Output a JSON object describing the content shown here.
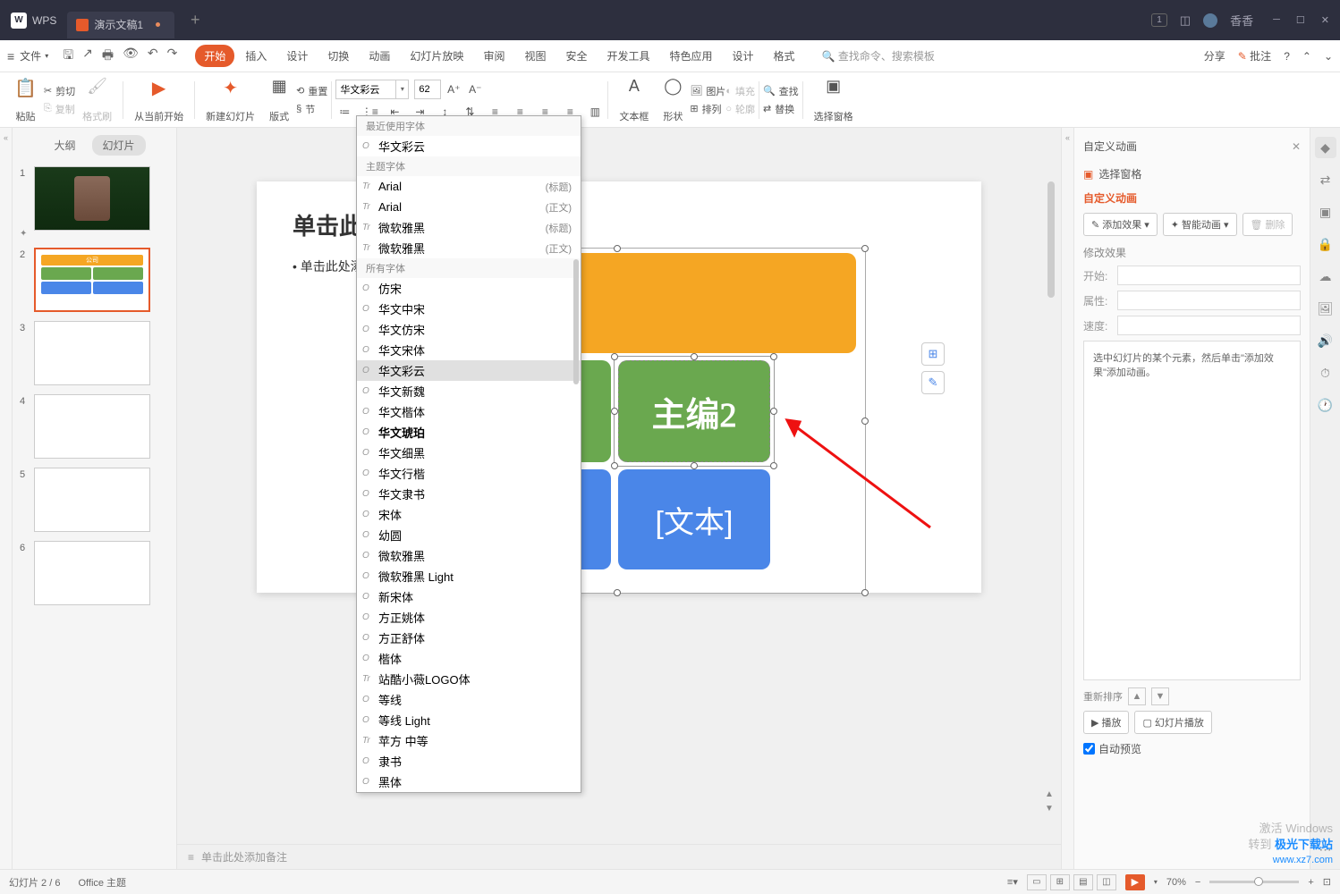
{
  "titlebar": {
    "app_name": "WPS",
    "doc_tab": "演示文稿1",
    "user_name": "香香",
    "badge": "1"
  },
  "menubar": {
    "file_label": "文件",
    "tabs": [
      "开始",
      "插入",
      "设计",
      "切换",
      "动画",
      "幻灯片放映",
      "审阅",
      "视图",
      "安全",
      "开发工具",
      "特色应用",
      "设计",
      "格式"
    ],
    "active_tab_index": 0,
    "search_placeholder": "查找命令、搜索模板",
    "share": "分享",
    "annotate": "批注"
  },
  "ribbon": {
    "paste": "粘贴",
    "cut": "剪切",
    "copy": "复制",
    "format_painter": "格式刷",
    "from_current": "从当前开始",
    "new_slide": "新建幻灯片",
    "layout": "版式",
    "section": "节",
    "reset": "重置",
    "font_name": "华文彩云",
    "font_size": "62",
    "text_box": "文本框",
    "shape": "形状",
    "picture": "图片",
    "arrange": "排列",
    "fill": "填充",
    "outline": "轮廓",
    "find": "查找",
    "replace": "替换",
    "select_pane": "选择窗格"
  },
  "left_panel": {
    "outline_tab": "大纲",
    "slides_tab": "幻灯片",
    "slide_count": 6,
    "selected": 2
  },
  "slide": {
    "title_text": "单击此处添加",
    "bullet_text": "单击此处添",
    "sa_selected_text": "主编2",
    "sa_text_placeholder": "[文本]"
  },
  "font_dropdown": {
    "section_recent": "最近使用字体",
    "recent": [
      {
        "name": "华文彩云",
        "icon": "O"
      }
    ],
    "section_theme": "主题字体",
    "theme": [
      {
        "name": "Arial",
        "tag": "(标题)",
        "icon": "Tr"
      },
      {
        "name": "Arial",
        "tag": "(正文)",
        "icon": "Tr"
      },
      {
        "name": "微软雅黑",
        "tag": "(标题)",
        "icon": "Tr"
      },
      {
        "name": "微软雅黑",
        "tag": "(正文)",
        "icon": "Tr"
      }
    ],
    "section_all": "所有字体",
    "all": [
      {
        "name": "仿宋",
        "icon": "O"
      },
      {
        "name": "华文中宋",
        "icon": "O"
      },
      {
        "name": "华文仿宋",
        "icon": "O"
      },
      {
        "name": "华文宋体",
        "icon": "O"
      },
      {
        "name": "华文彩云",
        "icon": "O",
        "hover": true
      },
      {
        "name": "华文新魏",
        "icon": "O"
      },
      {
        "name": "华文楷体",
        "icon": "O"
      },
      {
        "name": "华文琥珀",
        "icon": "O",
        "bold": true
      },
      {
        "name": "华文细黑",
        "icon": "O"
      },
      {
        "name": "华文行楷",
        "icon": "O"
      },
      {
        "name": "华文隶书",
        "icon": "O"
      },
      {
        "name": "宋体",
        "icon": "O"
      },
      {
        "name": "幼圆",
        "icon": "O"
      },
      {
        "name": "微软雅黑",
        "icon": "O"
      },
      {
        "name": "微软雅黑 Light",
        "icon": "O"
      },
      {
        "name": "新宋体",
        "icon": "O"
      },
      {
        "name": "方正姚体",
        "icon": "O"
      },
      {
        "name": "方正舒体",
        "icon": "O"
      },
      {
        "name": "楷体",
        "icon": "O"
      },
      {
        "name": "站酷小薇LOGO体",
        "icon": "Tr"
      },
      {
        "name": "等线",
        "icon": "O"
      },
      {
        "name": "等线 Light",
        "icon": "O"
      },
      {
        "name": "苹方 中等",
        "icon": "Tr"
      },
      {
        "name": "隶书",
        "icon": "O"
      },
      {
        "name": "黑体",
        "icon": "O"
      }
    ]
  },
  "right_panel": {
    "title": "自定义动画",
    "select_pane": "选择窗格",
    "section_title": "自定义动画",
    "add_effect": "添加效果",
    "smart_anim": "智能动画",
    "delete": "删除",
    "modify": "修改效果",
    "start_label": "开始:",
    "property_label": "属性:",
    "speed_label": "速度:",
    "hint": "选中幻灯片的某个元素，然后单击\"添加效果\"添加动画。",
    "reorder": "重新排序",
    "play": "播放",
    "slideshow": "幻灯片播放",
    "auto_preview": "自动预览"
  },
  "notes": {
    "placeholder": "单击此处添加备注"
  },
  "statusbar": {
    "slide_indicator": "幻灯片 2 / 6",
    "theme": "Office 主题",
    "zoom": "70%"
  },
  "watermark": {
    "line1": "激活 Windows",
    "line2": "转到",
    "brand": "极光下载站",
    "url": "www.xz7.com"
  }
}
